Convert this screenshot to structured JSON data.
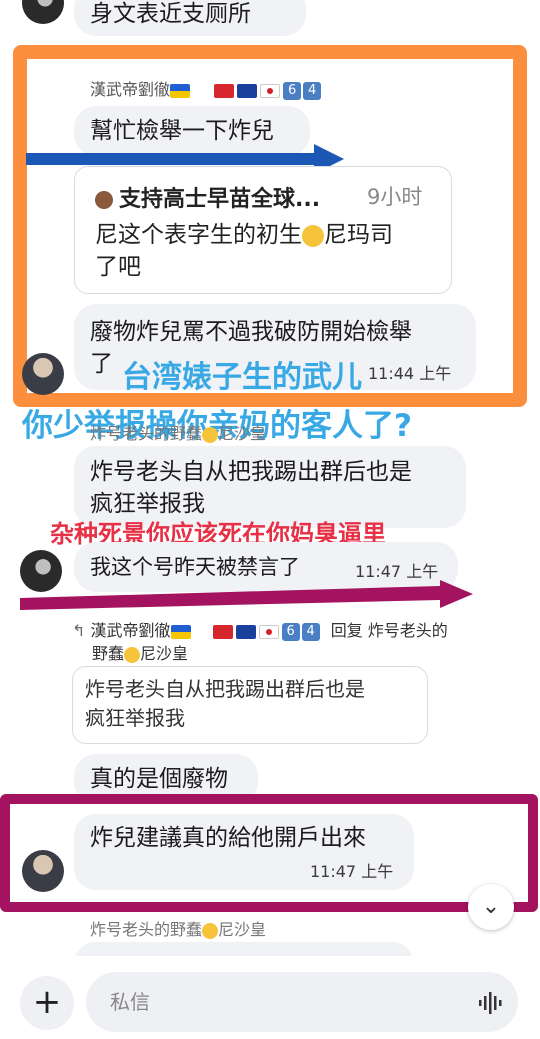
{
  "top_message": {
    "text": "身文表近支厕所"
  },
  "msg1": {
    "sender": "漢武帝劉徹",
    "bubble": "幫忙檢舉一下炸兒",
    "quote_title": "支持高士早苗全球...",
    "quote_time": "9小时",
    "quote_body_1": "尼这个表字生的初生",
    "quote_body_1b": "尼玛司",
    "quote_body_2": "了吧",
    "bubble2_line1": "廢物炸兒罵不過我破防開始檢舉",
    "bubble2_line2": "了",
    "bubble2_time": "11:44 上午"
  },
  "overlay": {
    "line1": "台湾婊子生的武儿",
    "line2": "你少举报操你亲妈的客人了?",
    "line3": "杂种死景你应该死在你妈臭逼里"
  },
  "msg2": {
    "sender": "炸号老头的野蠢",
    "sender_suffix": "尼沙皇",
    "bubble_line1": "炸号老头自从把我踢出群后也是",
    "bubble_line2": "疯狂举报我",
    "bubble2": "我这个号昨天被禁言了",
    "bubble2_time": "11:47 上午"
  },
  "msg3": {
    "sender": "漢武帝劉徹",
    "reply_label": "回复 炸号老头的",
    "reply_label2": "野蠢",
    "reply_label2_suffix": "尼沙皇",
    "quote_line1": "炸号老头自从把我踢出群后也是",
    "quote_line2": "疯狂举报我",
    "bubble1": "真的是個廢物",
    "bubble2": "炸兒建議真的給他開戶出來",
    "bubble2_time": "11:47 上午"
  },
  "msg4": {
    "sender": "炸号老头的野蠢",
    "sender_suffix": "尼沙皇"
  },
  "composer": {
    "placeholder": "私信",
    "add_icon": "plus-icon",
    "voice_icon": "voice-wave-icon"
  },
  "scroll_button": {
    "icon": "chevron-down-icon"
  },
  "colors": {
    "orange": "#fb8f3d",
    "blue_arrow": "#1b57b4",
    "magenta": "#a4135f",
    "cyan_text": "#38a9e5",
    "red_text": "#e63046"
  }
}
